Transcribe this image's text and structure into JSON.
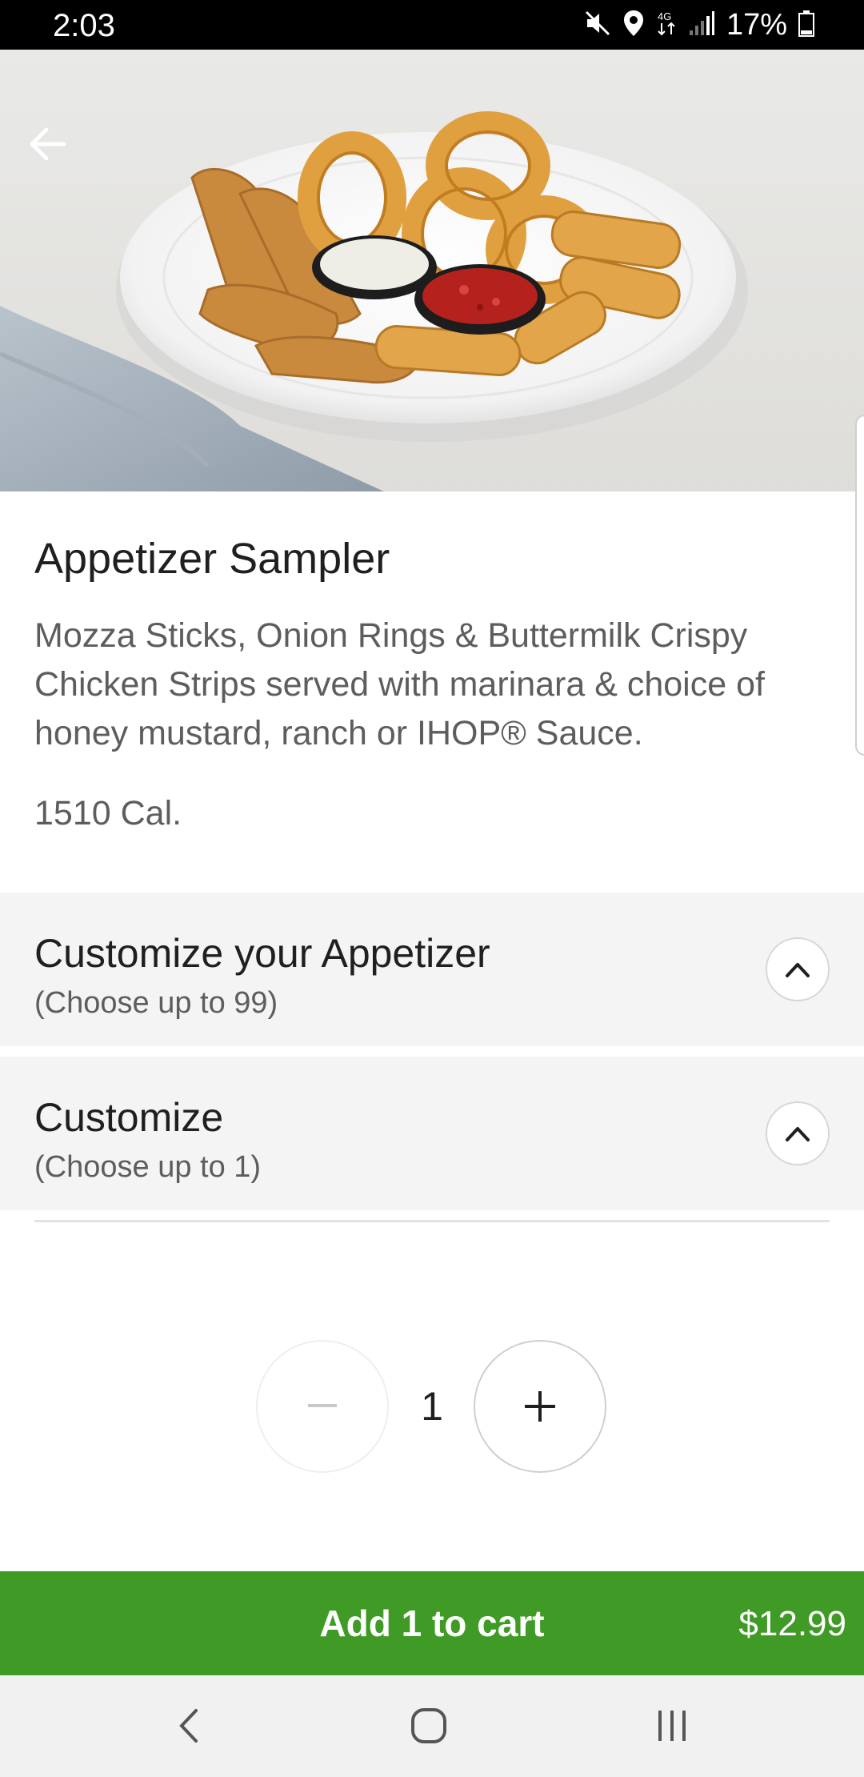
{
  "status_bar": {
    "time": "2:03",
    "battery": "17%",
    "icons": [
      "mute-icon",
      "location-icon",
      "data-4g-icon",
      "signal-icon",
      "battery-icon"
    ]
  },
  "hero": {
    "image_description_icons": [
      "back-arrow-icon"
    ]
  },
  "item": {
    "title": "Appetizer Sampler",
    "description": "Mozza Sticks, Onion Rings & Buttermilk Crispy Chicken Strips served with marinara & choice of honey mustard, ranch or IHOP® Sauce.",
    "calories": "1510 Cal."
  },
  "sections": [
    {
      "title": "Customize your Appetizer",
      "subtitle": "(Choose up to 99)",
      "icon": "chevron-up-icon"
    },
    {
      "title": "Customize",
      "subtitle": "(Choose up to 1)",
      "icon": "chevron-up-icon"
    }
  ],
  "stepper": {
    "quantity": "1",
    "minus_icon": "minus-icon",
    "plus_icon": "plus-icon"
  },
  "cart": {
    "label": "Add 1 to cart",
    "price": "$12.99",
    "color": "#3f9b25"
  },
  "nav_bar": {
    "icons": [
      "back-nav-icon",
      "home-nav-icon",
      "recents-nav-icon"
    ]
  }
}
